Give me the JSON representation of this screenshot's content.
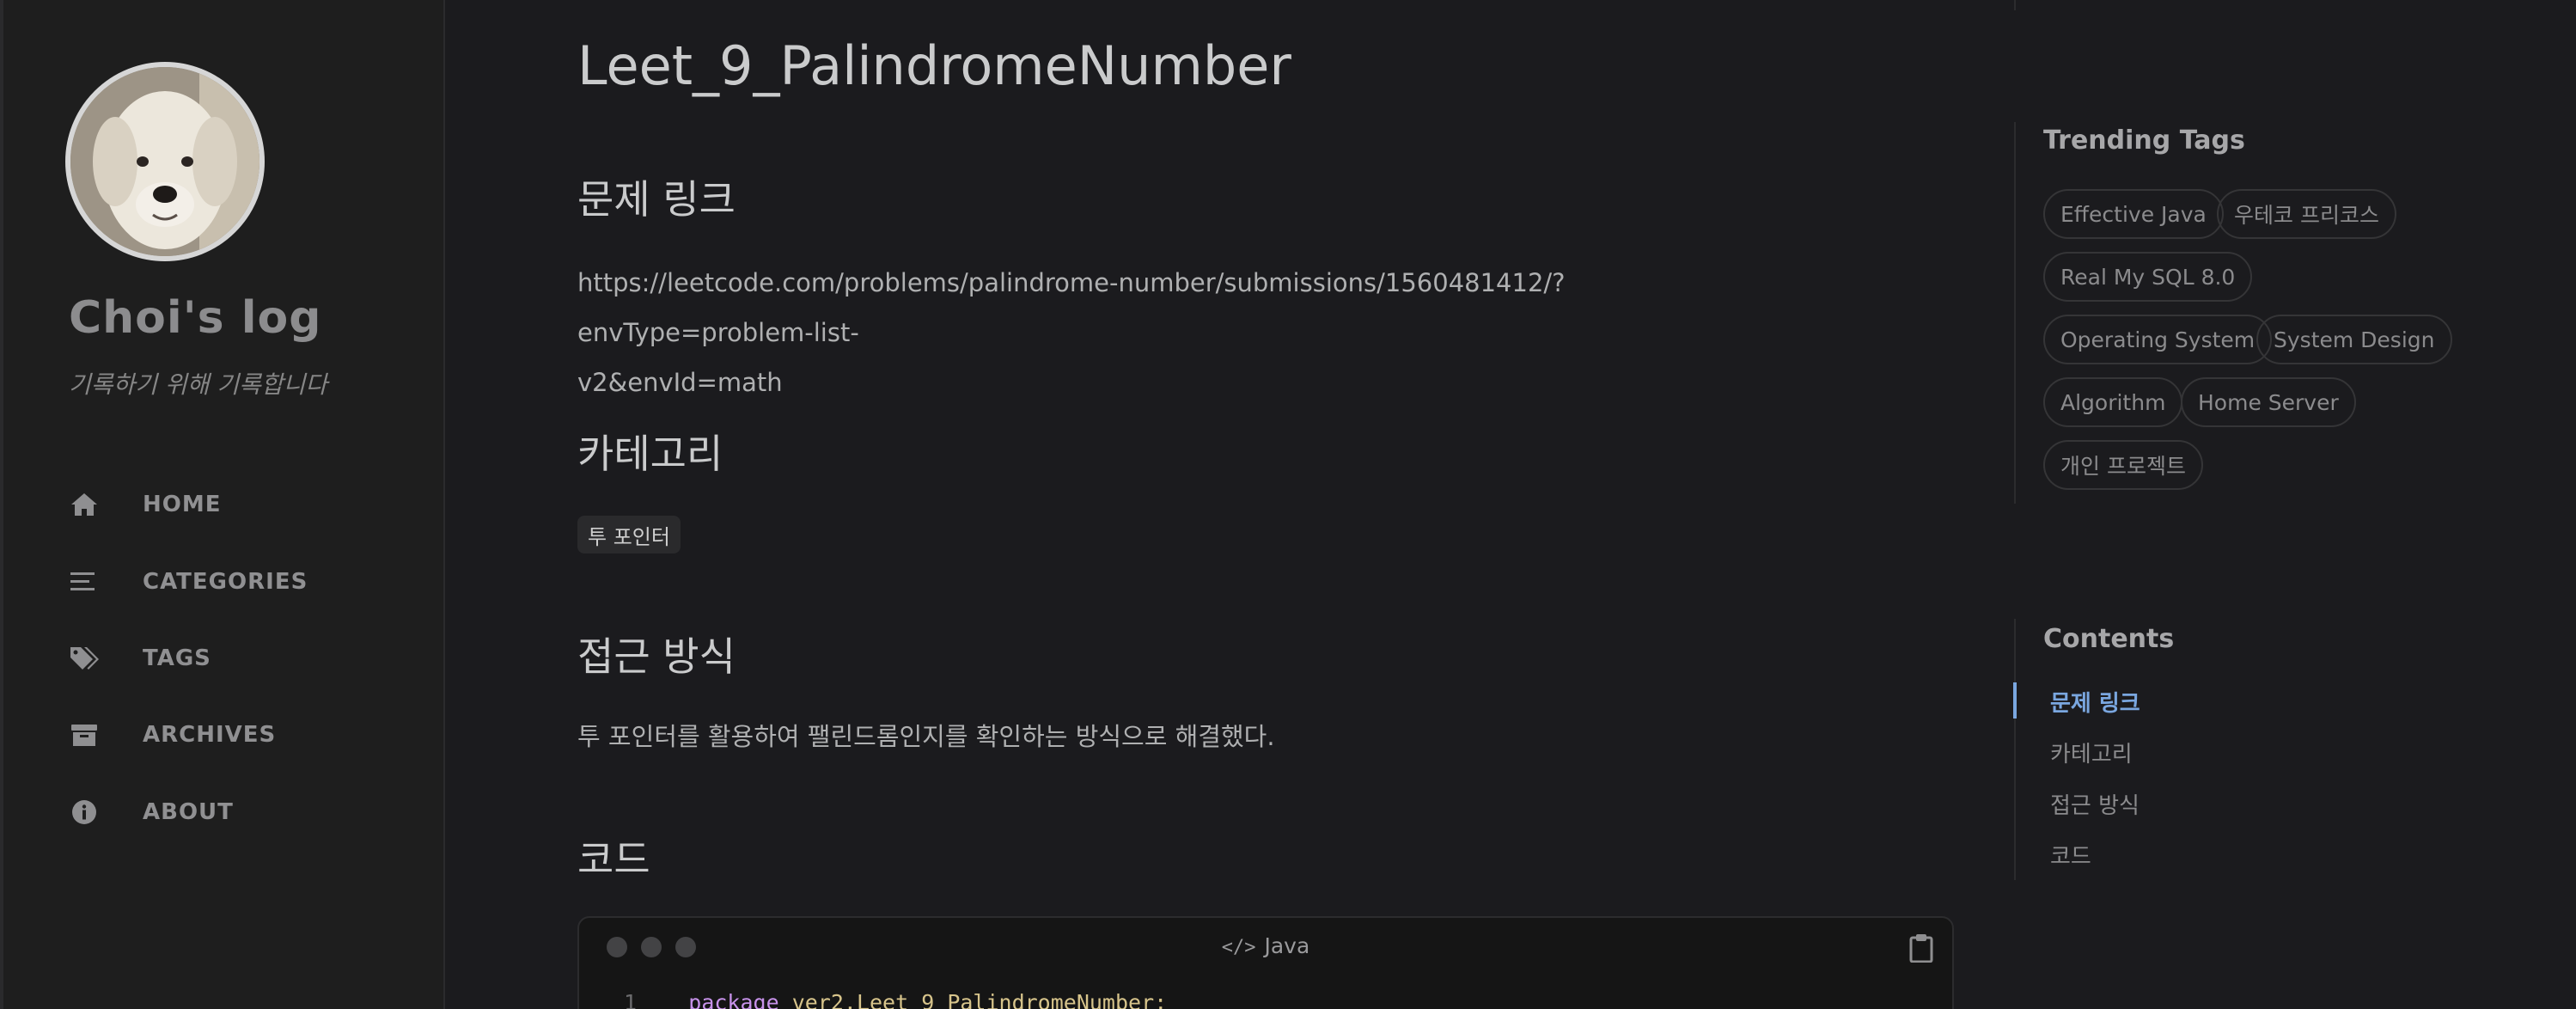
{
  "sidebar": {
    "site_title": "Choi's log",
    "site_subtitle": "기록하기 위해 기록합니다",
    "avatar": "dog-photo",
    "nav": [
      {
        "label": "HOME",
        "icon": "home-icon"
      },
      {
        "label": "CATEGORIES",
        "icon": "list-icon"
      },
      {
        "label": "TAGS",
        "icon": "tags-icon"
      },
      {
        "label": "ARCHIVES",
        "icon": "archive-icon"
      },
      {
        "label": "ABOUT",
        "icon": "info-icon"
      }
    ]
  },
  "post": {
    "title": "Leet_9_PalindromeNumber",
    "sections": {
      "link_heading": "문제 링크",
      "link_line1": "https://leetcode.com/problems/palindrome-number/submissions/1560481412/?envType=problem-list-",
      "link_line2": "v2&envId=math",
      "category_heading": "카테고리",
      "category_badge": "투 포인터",
      "approach_heading": "접근 방식",
      "approach_text": "투 포인터를 활용하여 팰린드롬인지를 확인하는 방식으로 해결했다.",
      "code_heading": "코드"
    },
    "code": {
      "language": "Java",
      "line_number": "1",
      "keyword": "package",
      "package_name": "ver2.Leet_9_PalindromeNumber;"
    }
  },
  "trending": {
    "title": "Trending Tags",
    "tags": [
      "Effective Java",
      "우테코 프리코스",
      "Real My SQL 8.0",
      "Operating System",
      "System Design",
      "Algorithm",
      "Home Server",
      "개인 프로젝트"
    ]
  },
  "toc": {
    "title": "Contents",
    "items": [
      "문제 링크",
      "카테고리",
      "접근 방식",
      "코드"
    ]
  },
  "colors": {
    "background": "#1b1b1e",
    "sidebar": "#1e1e1e",
    "toc_active": "#7aa7e0"
  }
}
